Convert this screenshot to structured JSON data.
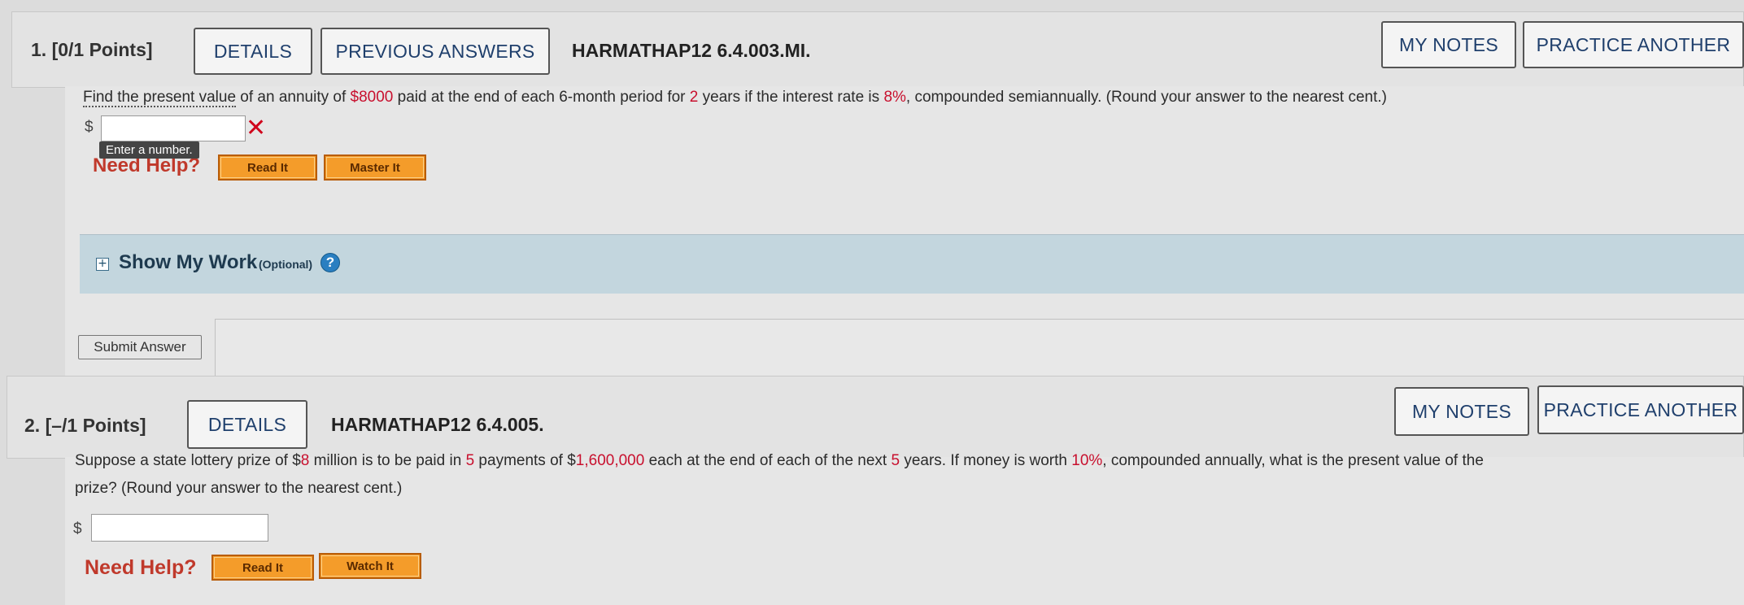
{
  "q1": {
    "number_label": "1. [0/1 Points]",
    "details": "DETAILS",
    "previous_answers": "PREVIOUS ANSWERS",
    "code": "HARMATHAP12 6.4.003.MI.",
    "my_notes": "MY NOTES",
    "practice_another": "PRACTICE ANOTHER",
    "text_parts": {
      "p1": "Find the present value",
      "p2": " of an annuity of ",
      "amount": "$8000",
      "p3": " paid at the end of each 6-month period for ",
      "years": "2",
      "p4": " years if the interest rate is ",
      "rate": "8%",
      "p5": ", compounded semiannually. (Round your answer to the nearest cent.)"
    },
    "currency": "$",
    "answer_value": "",
    "tooltip": "Enter a number.",
    "need_help": "Need Help?",
    "read_it": "Read It",
    "master_it": "Master It",
    "show_my_work": "Show My Work",
    "optional": "(Optional)",
    "help_icon": "?",
    "submit": "Submit Answer"
  },
  "q2": {
    "number_label": "2. [–/1 Points]",
    "details": "DETAILS",
    "code": "HARMATHAP12 6.4.005.",
    "my_notes": "MY NOTES",
    "practice_another": "PRACTICE ANOTHER",
    "text_parts": {
      "p1": "Suppose a state lottery prize of $",
      "million": "8",
      "p2": " million is to be paid in ",
      "payments": "5",
      "p3": " payments of $",
      "payment_amount": "1,600,000",
      "p4": " each at the end of each of the next ",
      "years": "5",
      "p5": " years. If money is worth ",
      "rate": "10%",
      "p6": ", compounded annually, what is the present value of the",
      "line2": "prize? (Round your answer to the nearest cent.)"
    },
    "currency": "$",
    "answer_value": "",
    "need_help": "Need Help?",
    "read_it": "Read It",
    "watch_it": "Watch It"
  }
}
